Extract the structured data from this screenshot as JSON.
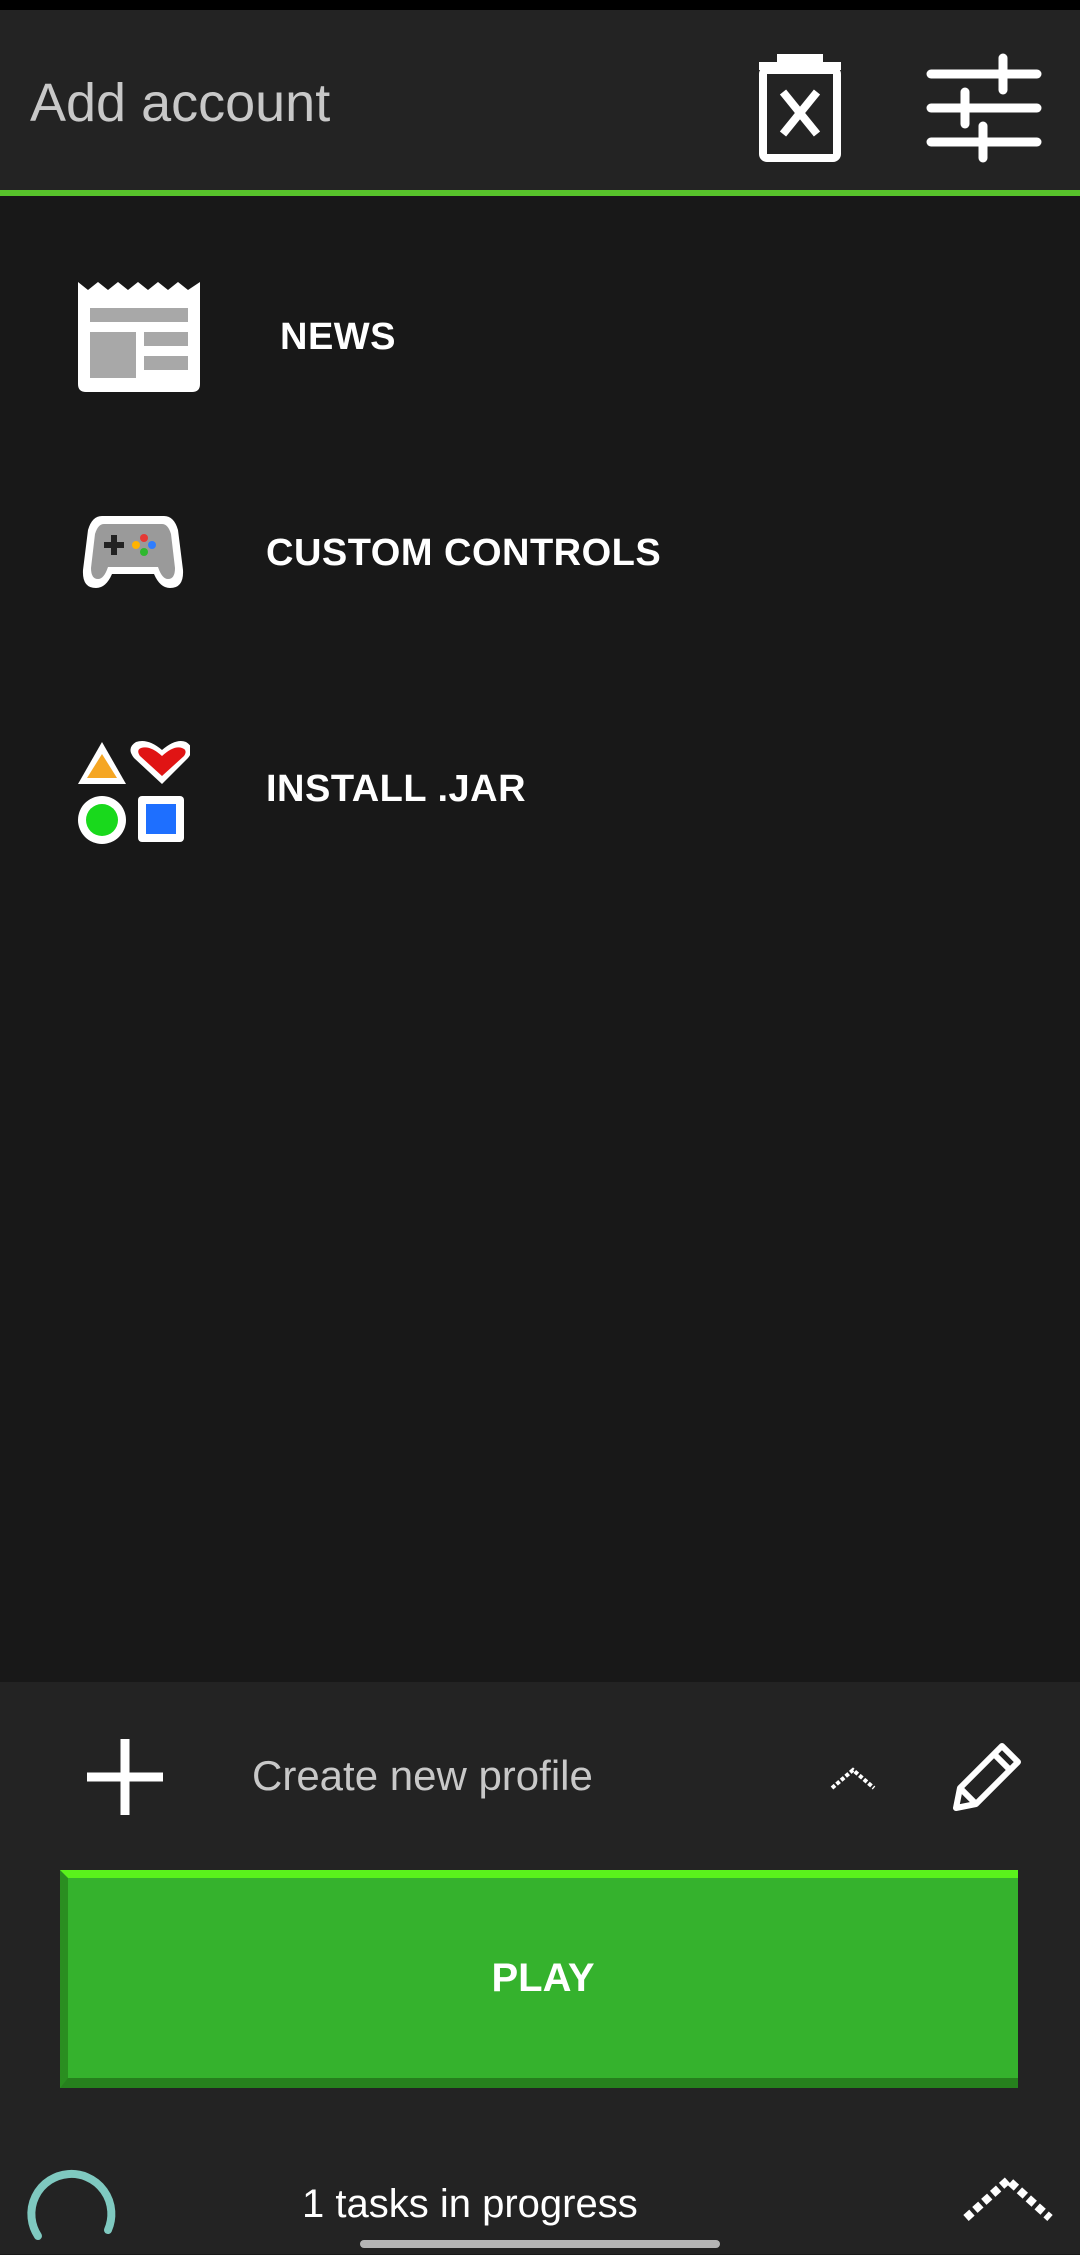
{
  "topbar": {
    "account_label": "Add account",
    "trash_icon": "trash-x-icon",
    "settings_icon": "sliders-icon",
    "accent_color": "#57c22b"
  },
  "menu": {
    "items": [
      {
        "label": "NEWS",
        "icon": "newspaper-icon"
      },
      {
        "label": "CUSTOM CONTROLS",
        "icon": "gamepad-icon"
      },
      {
        "label": "INSTALL .JAR",
        "icon": "shapes-icon"
      }
    ]
  },
  "profile": {
    "add_icon": "plus-icon",
    "selected": "Create new profile",
    "chevron_icon": "chevron-up-icon",
    "edit_icon": "pencil-icon"
  },
  "play": {
    "label": "PLAY",
    "color": "#35b22d"
  },
  "progress": {
    "text": "1 tasks in progress",
    "spinner_icon": "loading-spinner-icon",
    "expand_icon": "chevron-up-icon"
  }
}
